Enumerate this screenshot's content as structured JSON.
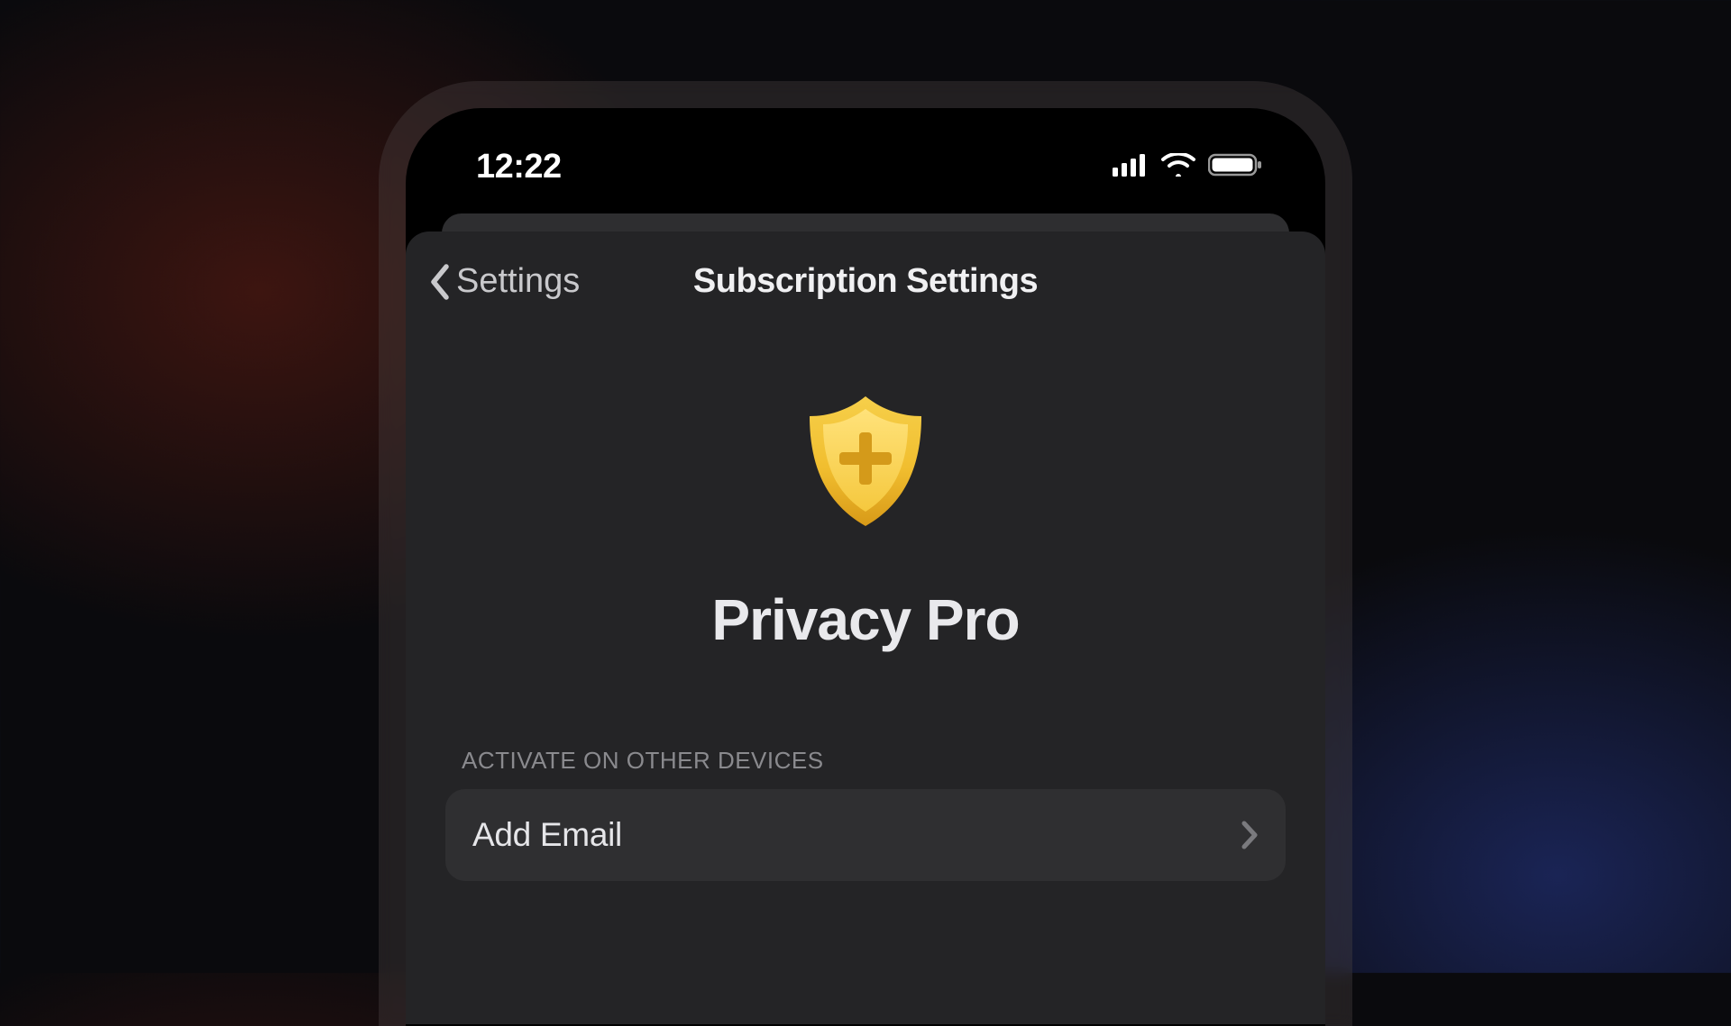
{
  "status": {
    "time": "12:22"
  },
  "nav": {
    "back_label": "Settings",
    "title": "Subscription Settings"
  },
  "hero": {
    "plan": "Privacy Pro"
  },
  "section": {
    "header": "ACTIVATE ON OTHER DEVICES",
    "add_email_label": "Add Email"
  }
}
